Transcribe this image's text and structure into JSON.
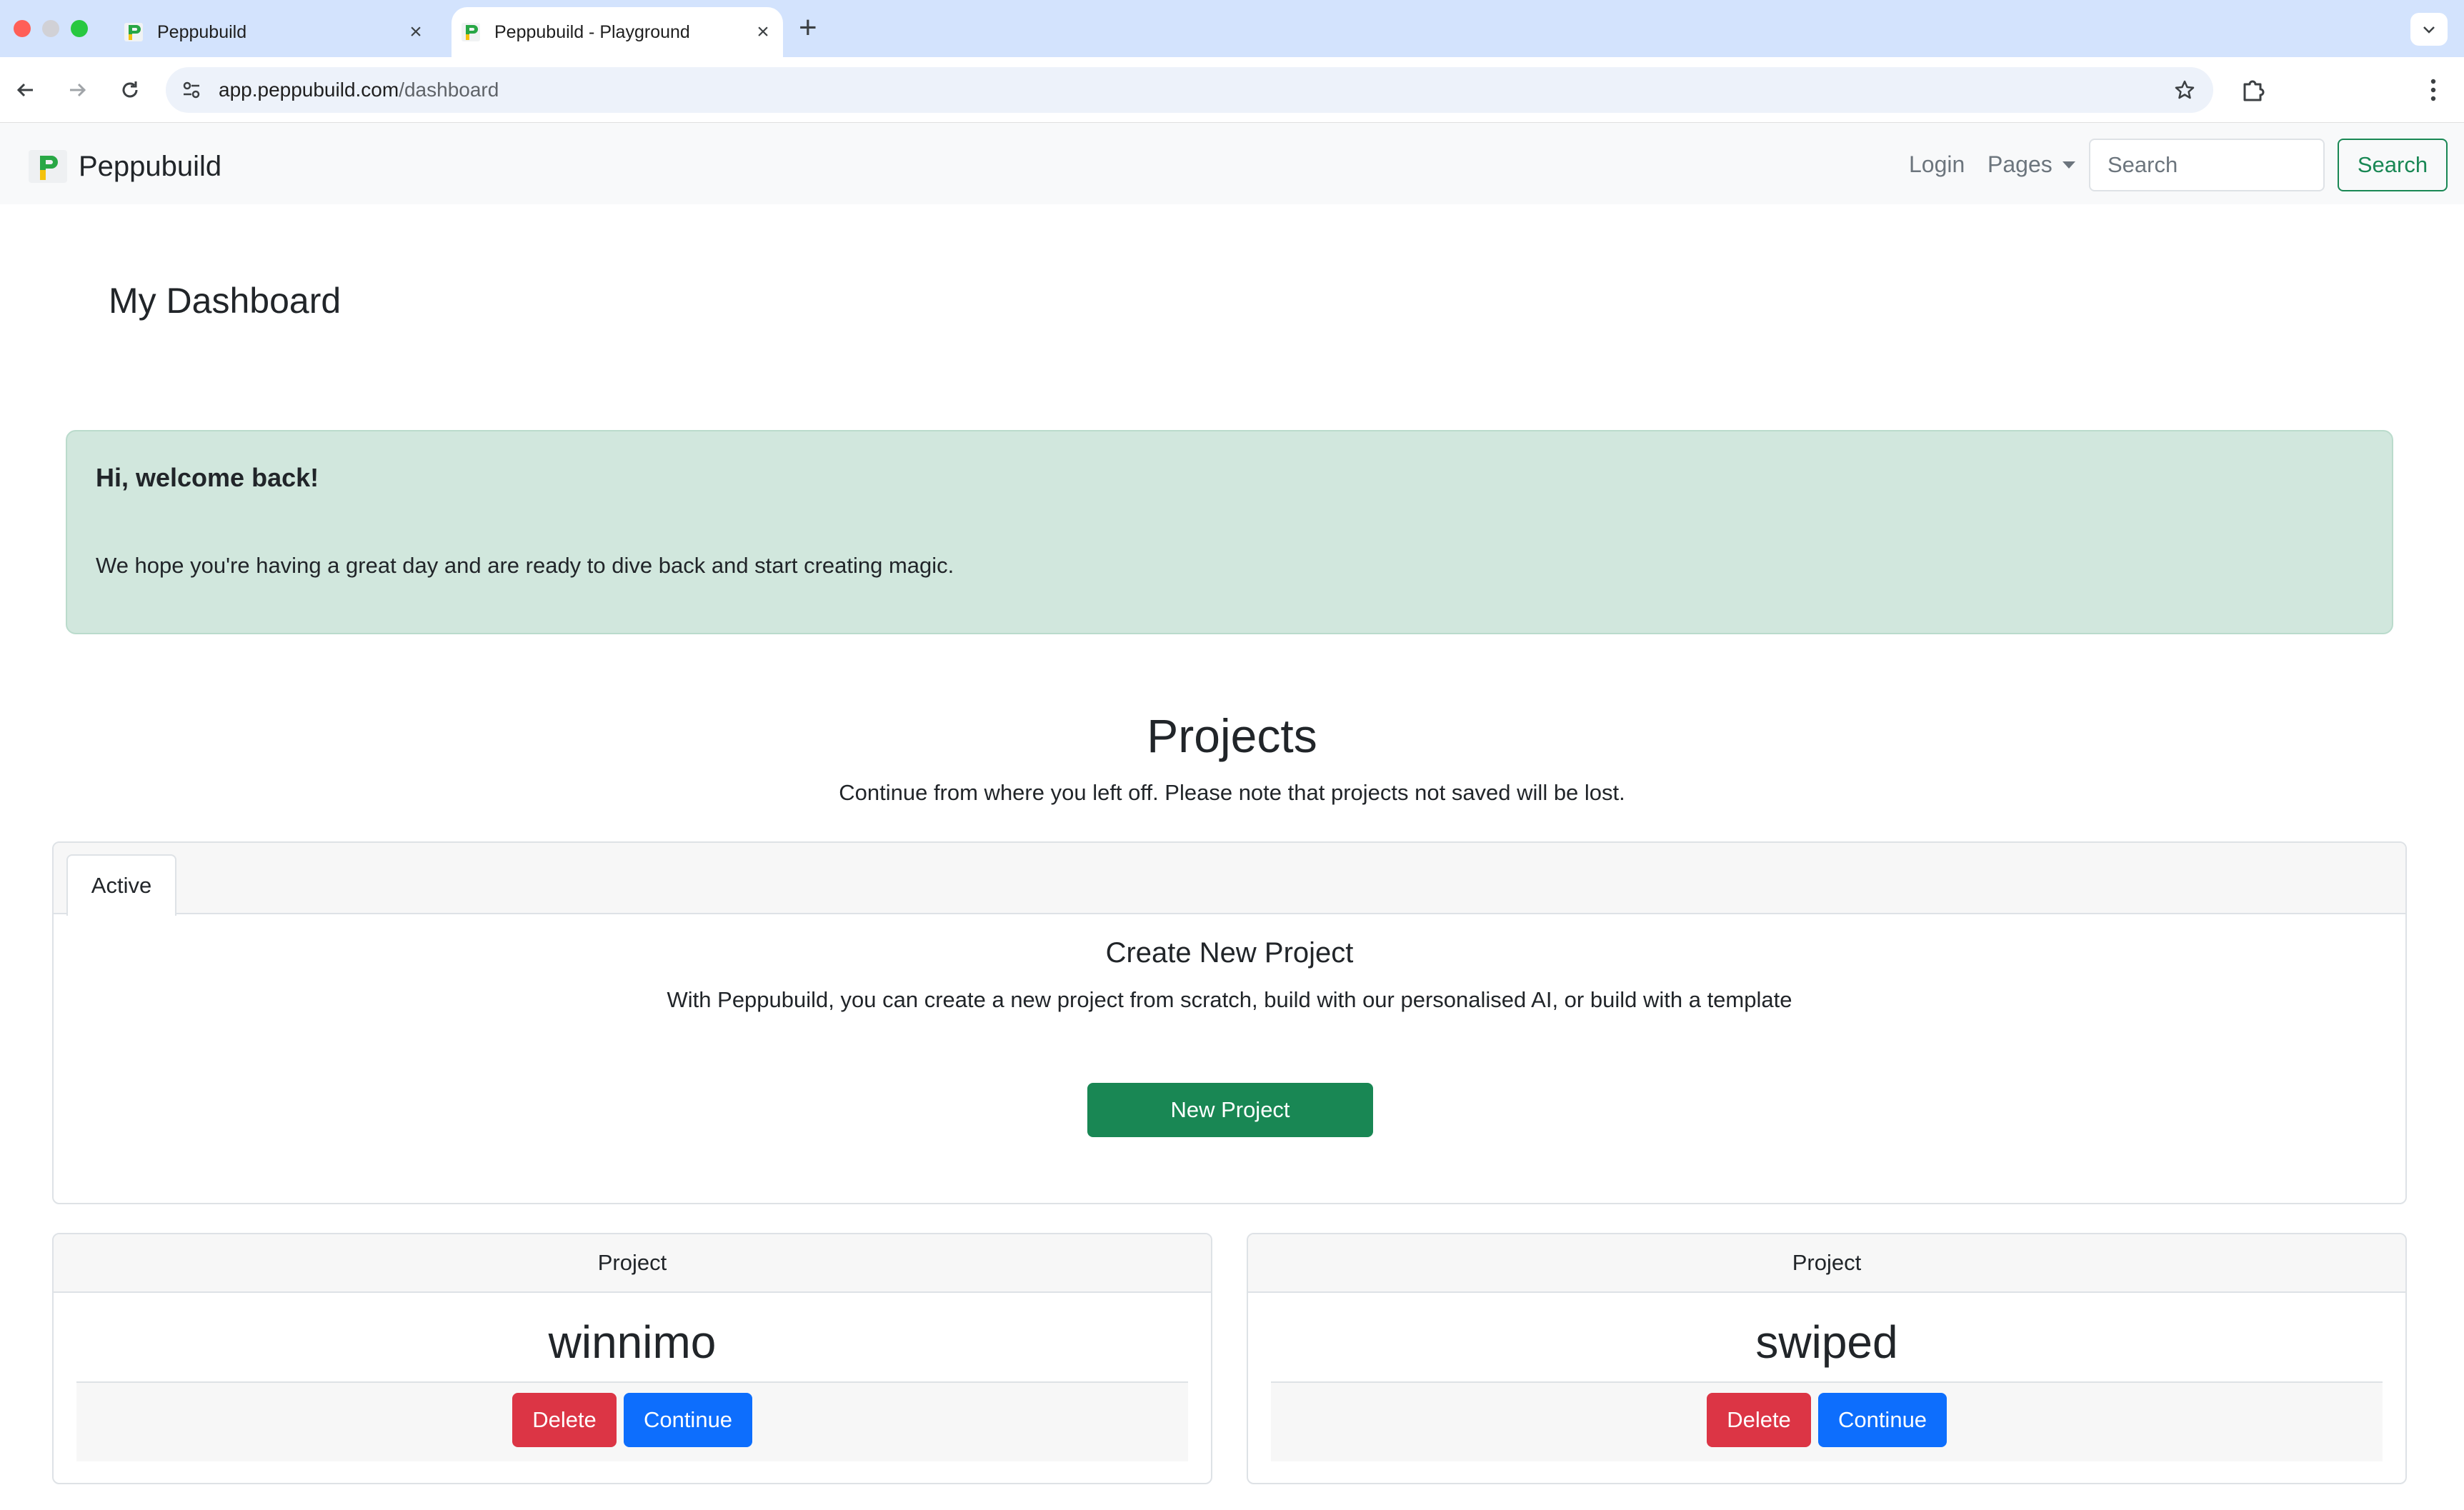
{
  "browser": {
    "tabs": [
      {
        "title": "Peppubuild",
        "close": "×"
      },
      {
        "title": "Peppubuild - Playground",
        "close": "×"
      }
    ],
    "new_tab_symbol": "+",
    "url_host": "app.peppubuild.com",
    "url_path": "/dashboard"
  },
  "navbar": {
    "brand": "Peppubuild",
    "login": "Login",
    "pages": "Pages",
    "search_placeholder": "Search",
    "search_button": "Search"
  },
  "page": {
    "title": "My Dashboard"
  },
  "welcome": {
    "heading": "Hi, welcome back!",
    "text": "We hope you're having a great day and are ready to dive back and start creating magic."
  },
  "projects": {
    "title": "Projects",
    "subtitle": "Continue from where you left off. Please note that projects not saved will be lost.",
    "tab_label": "Active",
    "create_title": "Create New Project",
    "create_desc": "With Peppubuild, you can create a new project from scratch, build with our personalised AI, or build with a template",
    "new_project_button": "New Project",
    "cards": [
      {
        "header": "Project",
        "name": "winnimo",
        "delete": "Delete",
        "continue": "Continue"
      },
      {
        "header": "Project",
        "name": "swiped",
        "delete": "Delete",
        "continue": "Continue"
      }
    ]
  },
  "colors": {
    "brand_green": "#198754",
    "alert_green": "#d1e7dd",
    "danger": "#dc3545",
    "primary": "#0d6efd",
    "chrome_tabbar": "#d3e3fd"
  },
  "icons": [
    "close-window-icon",
    "minimize-window-icon",
    "maximize-window-icon",
    "peppubuild-favicon",
    "back-arrow-icon",
    "forward-arrow-icon",
    "reload-icon",
    "site-settings-icon",
    "star-icon",
    "extensions-icon",
    "more-vert-icon",
    "chevron-down-icon",
    "caret-down-icon"
  ]
}
